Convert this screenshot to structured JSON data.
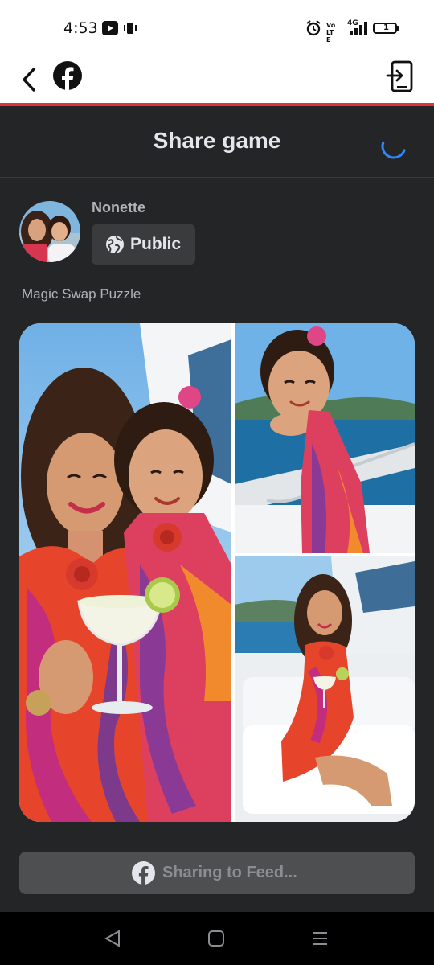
{
  "status_bar": {
    "time": "4:53",
    "left_icons": [
      "media-player-icon",
      "vibrate-icon"
    ],
    "right_icons": [
      "alarm-icon",
      "volte-icon",
      "signal-4g-icon",
      "battery-icon"
    ],
    "network": "4G",
    "volte": "Vo LTE",
    "battery_level": "1"
  },
  "app_bar": {
    "back_icon": "back-arrow-icon",
    "logo_icon": "facebook-logo-icon",
    "exit_icon": "exit-app-icon",
    "accent_color": "#e0313c"
  },
  "sheet": {
    "title": "Share game",
    "loading": true
  },
  "composer": {
    "user_name": "Nonette",
    "privacy_label": "Public",
    "privacy_icon": "globe-icon",
    "game_name": "Magic Swap Puzzle"
  },
  "collage": {
    "panels": [
      "left-large-photo",
      "top-right-photo",
      "bottom-right-photo"
    ]
  },
  "share_button": {
    "label": "Sharing to Feed...",
    "icon": "facebook-icon",
    "disabled": true
  },
  "nav_bar": {
    "buttons": [
      "nav-back-icon",
      "nav-home-icon",
      "nav-recents-icon"
    ]
  }
}
